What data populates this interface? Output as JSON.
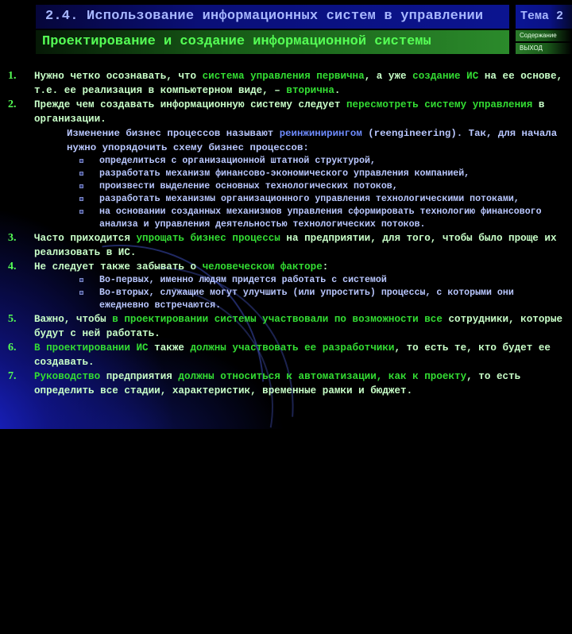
{
  "header": {
    "title": "2.4. Использование информационных систем в управлении",
    "subtitle": "Проектирование и создание информационной системы",
    "topic": "Тема 2",
    "nav": {
      "contents": "Содержание",
      "exit": "ВЫХОД"
    }
  },
  "items": [
    {
      "number": "1.",
      "segments": [
        {
          "text": "Нужно четко осознавать, что ",
          "hl": false
        },
        {
          "text": "система управления первична",
          "hl": true
        },
        {
          "text": ", а уже ",
          "hl": false
        },
        {
          "text": "создание ИС",
          "hl": true
        },
        {
          "text": " на ее основе, т.е. ее реализация в компьютерном виде, – ",
          "hl": false
        },
        {
          "text": "вторична",
          "hl": true
        },
        {
          "text": ".",
          "hl": false
        }
      ]
    },
    {
      "number": "2.",
      "segments": [
        {
          "text": "Прежде чем создавать информационную систему следует ",
          "hl": false
        },
        {
          "text": "пересмотреть систему управления",
          "hl": true
        },
        {
          "text": " в организации.",
          "hl": false
        }
      ],
      "note": {
        "before": "Изменение бизнес процессов называют ",
        "term": "реинжинирингом",
        "after": " (reengineering). Так, для начала нужно упорядочить схему бизнес процессов:"
      },
      "bullets": [
        "определиться с организационной штатной структурой,",
        "разработать механизм финансово-экономического управления компанией,",
        "произвести выделение основных технологических потоков,",
        "разработать механизмы организационного управления технологическими потоками,",
        "на основании созданных механизмов управления сформировать технологию финансового анализа и управления деятельностью технологических потоков."
      ]
    },
    {
      "number": "3.",
      "segments": [
        {
          "text": "Часто приходится ",
          "hl": false
        },
        {
          "text": "упрощать бизнес процессы",
          "hl": true
        },
        {
          "text": " на предприятии, для того, чтобы было проще их реализовать в ИС.",
          "hl": false
        }
      ]
    },
    {
      "number": "4.",
      "segments": [
        {
          "text": "Не следует также забывать о ",
          "hl": false
        },
        {
          "text": "человеческом факторе",
          "hl": true
        },
        {
          "text": ":",
          "hl": false
        }
      ],
      "bullets": [
        "Во-первых, именно людям придется работать с системой",
        "Во-вторых, служащие могут улучшить (или упростить) процессы, с которыми они ежедневно встречаются."
      ]
    },
    {
      "number": "5.",
      "segments": [
        {
          "text": "Важно, чтобы ",
          "hl": false
        },
        {
          "text": "в проектировании системы участвовали по возможности все",
          "hl": true
        },
        {
          "text": " сотрудники, которые будут с ней работать.",
          "hl": false
        }
      ]
    },
    {
      "number": "6.",
      "segments": [
        {
          "text": "В проектировании ИС",
          "hl": true
        },
        {
          "text": " также ",
          "hl": false
        },
        {
          "text": "должны участвовать ее разработчики",
          "hl": true
        },
        {
          "text": ", то есть те, кто будет ее создавать.",
          "hl": false
        }
      ]
    },
    {
      "number": "7.",
      "segments": [
        {
          "text": "Руководство",
          "hl": true
        },
        {
          "text": " предприятия ",
          "hl": false
        },
        {
          "text": "должны относиться к автоматизации, как к проекту",
          "hl": true
        },
        {
          "text": ", то есть определить все стадии, характеристик, временные рамки и бюджет.",
          "hl": false
        }
      ]
    }
  ]
}
